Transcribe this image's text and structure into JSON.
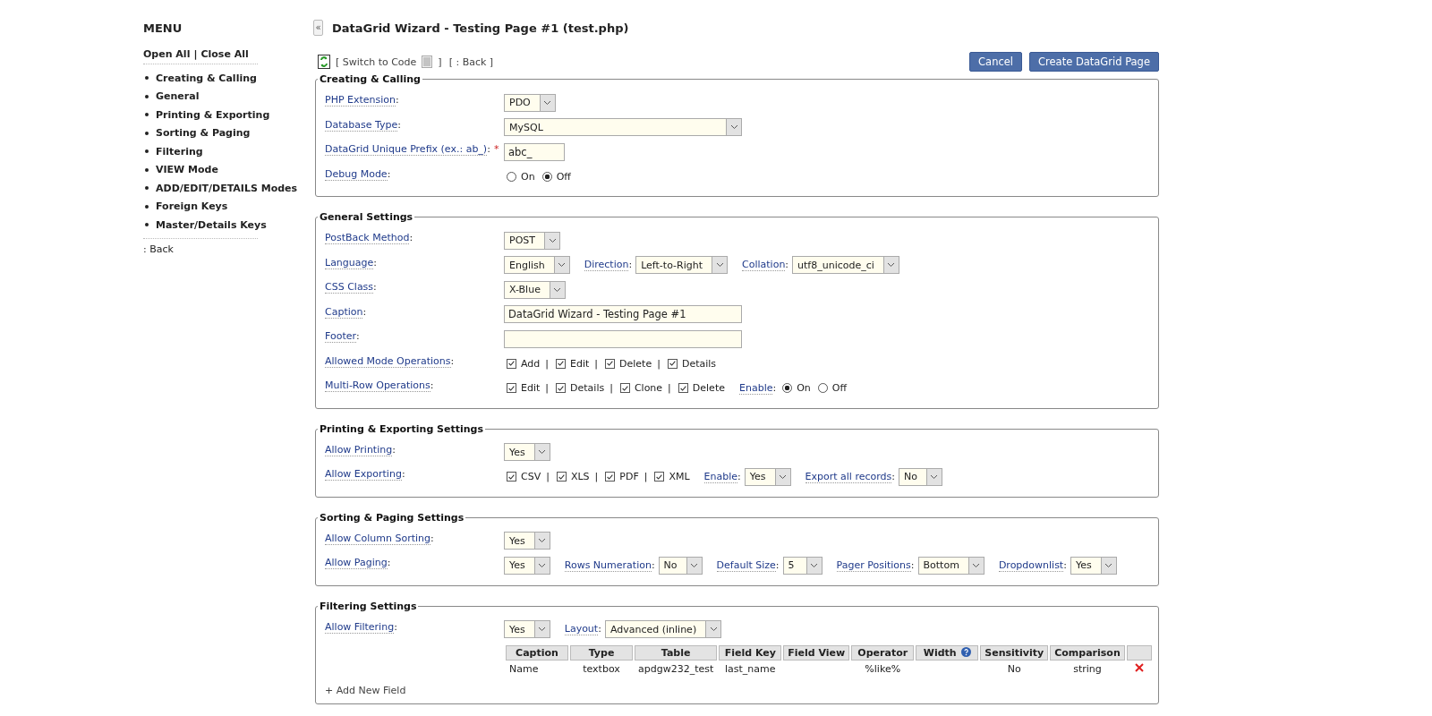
{
  "sidebar": {
    "title": "MENU",
    "open_all": "Open All",
    "separator": "|",
    "close_all": "Close All",
    "items": [
      {
        "label": "Creating & Calling"
      },
      {
        "label": "General"
      },
      {
        "label": "Printing & Exporting"
      },
      {
        "label": "Sorting & Paging"
      },
      {
        "label": "Filtering"
      },
      {
        "label": "VIEW Mode"
      },
      {
        "label": "ADD/EDIT/DETAILS Modes"
      },
      {
        "label": "Foreign Keys"
      },
      {
        "label": "Master/Details Keys"
      }
    ],
    "back": ": Back"
  },
  "collapse_button": "«",
  "label_colon": ":",
  "page_title": "DataGrid Wizard - Testing Page #1 (test.php)",
  "toolbar": {
    "switch_open": "[ Switch to Code",
    "switch_close": "]",
    "back": "[ : Back ]",
    "buttons": [
      "Cancel",
      "Create DataGrid Page"
    ]
  },
  "sections": [
    {
      "title": "Creating & Calling",
      "rows": [
        {
          "label": "PHP Extension",
          "items": [
            {
              "kind": "select",
              "value": "PDO"
            }
          ]
        },
        {
          "label": "Database Type",
          "items": [
            {
              "kind": "select",
              "value": "MySQL",
              "wide": true
            }
          ]
        },
        {
          "label": "DataGrid Unique Prefix (ex.: ab_)",
          "required_mark": "*",
          "items": [
            {
              "kind": "input",
              "value": "abc_"
            }
          ]
        },
        {
          "label": "Debug Mode",
          "items": [
            {
              "kind": "radios",
              "options": [
                {
                  "label": "On",
                  "selected": false
                },
                {
                  "label": "Off",
                  "selected": true
                }
              ]
            }
          ]
        }
      ]
    },
    {
      "title": "General Settings",
      "rows": [
        {
          "label": "PostBack Method",
          "items": [
            {
              "kind": "select",
              "value": "POST"
            }
          ]
        },
        {
          "label": "Language",
          "items": [
            {
              "kind": "select",
              "value": "English",
              "wide": false
            },
            {
              "kind": "select",
              "label": "Direction",
              "value": "Left-to-Right"
            },
            {
              "kind": "select",
              "label": "Collation",
              "value": "utf8_unicode_ci"
            }
          ]
        },
        {
          "label": "CSS Class",
          "items": [
            {
              "kind": "select",
              "value": "X-Blue"
            }
          ]
        },
        {
          "label": "Caption",
          "items": [
            {
              "kind": "input",
              "value": "DataGrid Wizard - Testing Page #1",
              "wide": true
            }
          ]
        },
        {
          "label": "Footer",
          "items": [
            {
              "kind": "input",
              "wide": true
            }
          ]
        },
        {
          "label": "Allowed Mode Operations",
          "items": [
            {
              "kind": "checks",
              "separator": "|",
              "options": [
                {
                  "label": "Add",
                  "checked": true
                },
                {
                  "label": "Edit",
                  "checked": true
                },
                {
                  "label": "Delete",
                  "checked": true
                },
                {
                  "label": "Details",
                  "checked": true
                }
              ]
            }
          ]
        },
        {
          "label": "Multi-Row Operations",
          "items": [
            {
              "kind": "checks",
              "separator": "|",
              "options": [
                {
                  "label": "Edit",
                  "checked": true
                },
                {
                  "label": "Details",
                  "checked": true
                },
                {
                  "label": "Clone",
                  "checked": true
                },
                {
                  "label": "Delete",
                  "checked": true
                }
              ]
            },
            {
              "kind": "radios",
              "label": "Enable",
              "options": [
                {
                  "label": "On",
                  "selected": true
                },
                {
                  "label": "Off",
                  "selected": false
                }
              ]
            }
          ]
        }
      ]
    },
    {
      "title": "Printing & Exporting Settings",
      "rows": [
        {
          "label": "Allow Printing",
          "items": [
            {
              "kind": "select",
              "value": "Yes"
            }
          ]
        },
        {
          "label": "Allow Exporting",
          "items": [
            {
              "kind": "checks",
              "separator": "|",
              "options": [
                {
                  "label": "CSV",
                  "checked": true
                },
                {
                  "label": "XLS",
                  "checked": true
                },
                {
                  "label": "PDF",
                  "checked": true
                },
                {
                  "label": "XML",
                  "checked": true
                }
              ]
            },
            {
              "kind": "select",
              "label": "Enable",
              "value": "Yes"
            },
            {
              "kind": "select",
              "label": "Export all records",
              "value": "No"
            }
          ]
        }
      ]
    },
    {
      "title": "Sorting & Paging Settings",
      "rows": [
        {
          "label": "Allow Column Sorting",
          "items": [
            {
              "kind": "select",
              "value": "Yes"
            }
          ]
        },
        {
          "label": "Allow Paging",
          "items": [
            {
              "kind": "select",
              "value": "Yes"
            },
            {
              "kind": "select",
              "label": "Rows Numeration",
              "value": "No"
            },
            {
              "kind": "select",
              "label": "Default Size",
              "value": "5"
            },
            {
              "kind": "select",
              "label": "Pager Positions",
              "value": "Bottom"
            },
            {
              "kind": "select",
              "label": "Dropdownlist",
              "value": "Yes"
            }
          ]
        }
      ]
    },
    {
      "title": "Filtering Settings",
      "rows": [
        {
          "label": "Allow Filtering",
          "items": [
            {
              "kind": "select",
              "value": "Yes"
            },
            {
              "kind": "select",
              "label": "Layout",
              "value": "Advanced (inline)"
            }
          ]
        }
      ],
      "table": {
        "columns": [
          {
            "label": "Caption"
          },
          {
            "label": "Type"
          },
          {
            "label": "Table"
          },
          {
            "label": "Field Key"
          },
          {
            "label": "Field View"
          },
          {
            "label": "Operator"
          },
          {
            "label": "Width",
            "help": true
          },
          {
            "label": "Sensitivity"
          },
          {
            "label": "Comparison"
          }
        ],
        "rows": [
          {
            "cells": [
              "Name",
              "textbox",
              "apdgw232_test",
              "last_name",
              "",
              "%like%",
              "",
              "No",
              "string"
            ],
            "deletable": true
          }
        ]
      },
      "add_link": "+ Add New Field"
    }
  ]
}
